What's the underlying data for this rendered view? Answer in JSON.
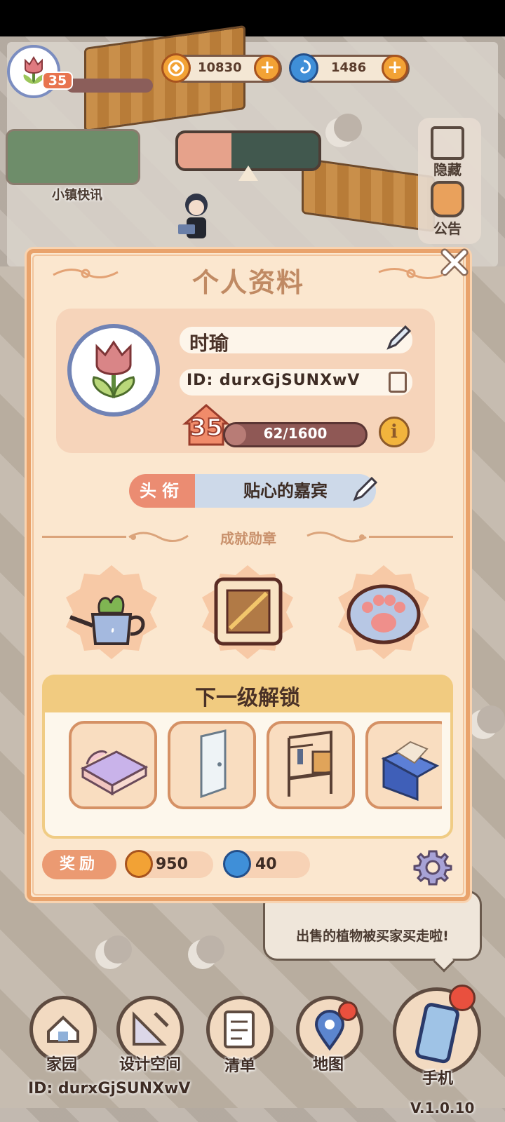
{
  "hud": {
    "level": "35",
    "coins": "10830",
    "gems": "1486"
  },
  "news": {
    "label": "小镇快讯"
  },
  "side": {
    "hide_label": "隐藏",
    "notice_label": "公告"
  },
  "dialog": {
    "title": "个人资料",
    "name": "时瑜",
    "id_text": "ID: durxGjSUNXwV",
    "level": "35",
    "exp_text": "62/1600",
    "exp_progress": 0.04,
    "title_label": "头衔",
    "title_value": "贴心的嘉宾",
    "achievements_title": "成就勋章",
    "achievements": [
      "watering-can-medal",
      "stamp-medal",
      "paw-medal"
    ],
    "unlock_title": "下一级解锁",
    "unlock_items": [
      "bed",
      "door",
      "clothes-rack",
      "book-stand"
    ],
    "reward_label": "奖励",
    "reward_coins": "950",
    "reward_gems": "40"
  },
  "bubble": {
    "text": "出售的植物被买家买走啦!"
  },
  "nav": {
    "home": "家园",
    "design": "设计空间",
    "list": "清单",
    "map": "地图",
    "phone": "手机"
  },
  "footer": {
    "id": "ID: durxGjSUNXwV",
    "version": "V.1.0.10"
  },
  "colors": {
    "accent": "#e9a36c",
    "panel": "#fbe7cf",
    "coin": "#f2a235",
    "gem": "#3f8fd8",
    "badge": "#e9503e"
  }
}
